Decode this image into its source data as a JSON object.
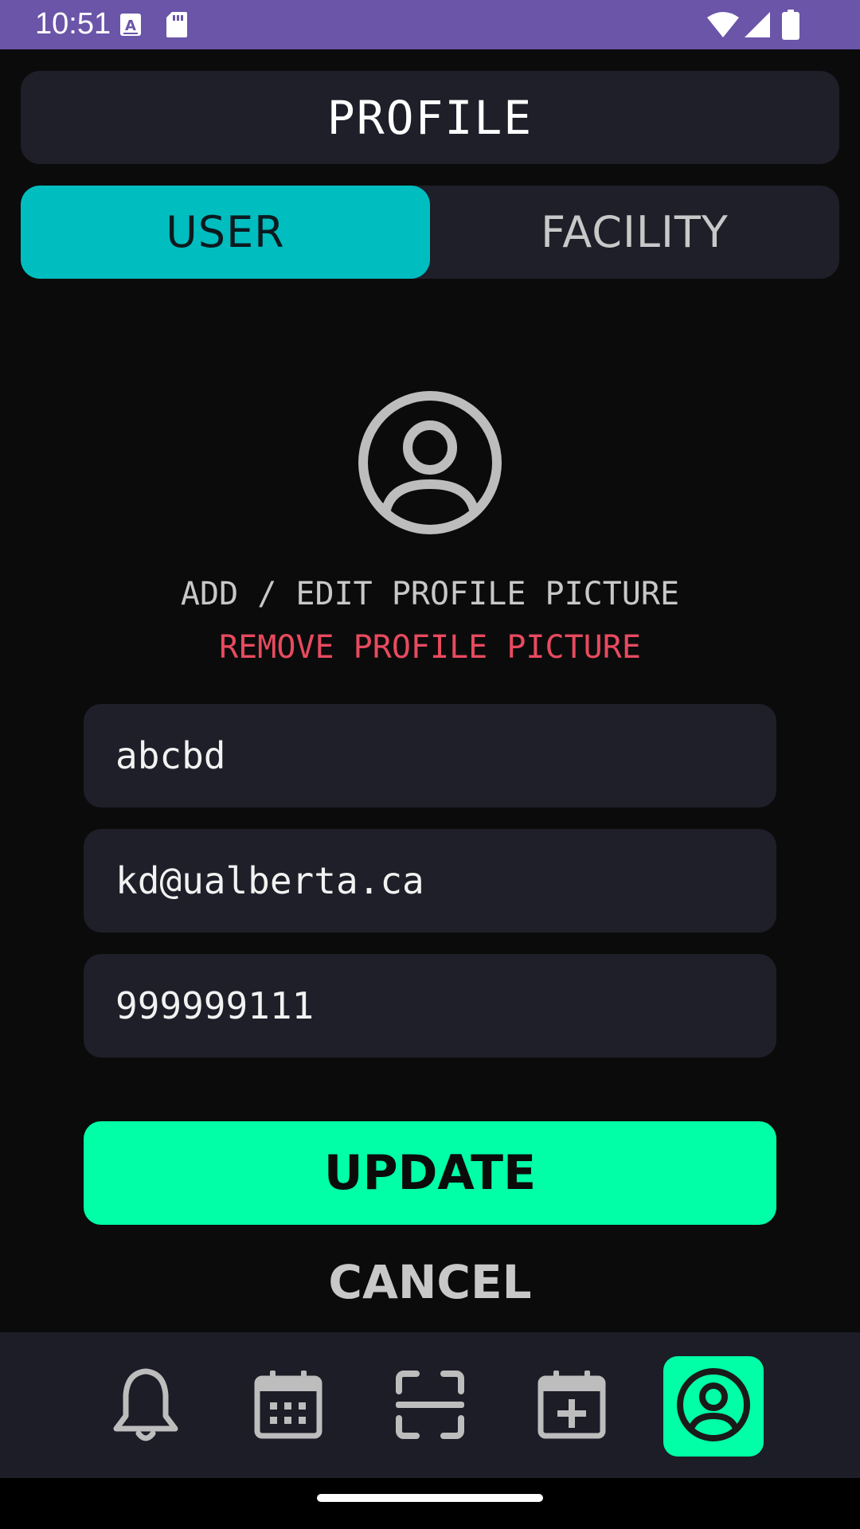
{
  "status_bar": {
    "time": "10:51",
    "icons": [
      "a-letter-icon",
      "sd-card-icon",
      "wifi-icon",
      "signal-icon",
      "battery-icon"
    ]
  },
  "header": {
    "title": "PROFILE"
  },
  "tabs": [
    {
      "label": "USER",
      "selected": true
    },
    {
      "label": "FACILITY",
      "selected": false
    }
  ],
  "avatar": {
    "icon": "account-circle-icon"
  },
  "profile_picture": {
    "add_edit_label": "ADD / EDIT PROFILE PICTURE",
    "remove_label": "REMOVE PROFILE PICTURE"
  },
  "form": {
    "name_value": "abcbd",
    "email_value": "kd@ualberta.ca",
    "phone_value": "999999111"
  },
  "actions": {
    "update_label": "UPDATE",
    "cancel_label": "CANCEL"
  },
  "bottom_nav": {
    "items": [
      {
        "icon": "bell-icon",
        "active": false
      },
      {
        "icon": "calendar-icon",
        "active": false
      },
      {
        "icon": "scan-icon",
        "active": false
      },
      {
        "icon": "calendar-add-icon",
        "active": false
      },
      {
        "icon": "profile-icon",
        "active": true
      }
    ]
  },
  "colors": {
    "status_bar": "#6a55a8",
    "background": "#0b0b0b",
    "surface": "#1e1f29",
    "tab_selected": "#00bdc0",
    "accent": "#00ffa6",
    "danger": "#e84a5f",
    "muted_text": "#c8c8c8"
  }
}
